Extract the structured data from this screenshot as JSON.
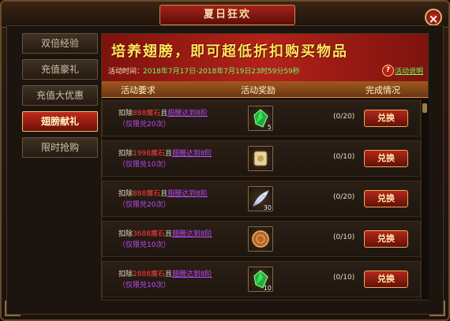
{
  "window": {
    "title": "夏日狂欢",
    "close_label": "×"
  },
  "nav": {
    "items": [
      {
        "label": "双倍经验",
        "active": false
      },
      {
        "label": "充值豪礼",
        "active": false
      },
      {
        "label": "充值大优惠",
        "active": false
      },
      {
        "label": "翅膀献礼",
        "active": true
      },
      {
        "label": "限时抢购",
        "active": false
      }
    ]
  },
  "banner": {
    "title": "培养翅膀，即可超低折扣购买物品",
    "time_label": "活动时间：",
    "time_value": "2018年7月17日-2018年7月19日23时59分59秒",
    "help_icon": "?",
    "rule_link": "活动说明"
  },
  "columns": {
    "requirement": "活动要求",
    "reward": "活动奖励",
    "status": "完成情况"
  },
  "rows": [
    {
      "prefix": "扣除",
      "price": "888魔石",
      "conjunction": "且",
      "level": "翅膀达到8阶",
      "limit": "（仅限兑20次）",
      "item_icon": "green-gem-icon",
      "item_count": "5",
      "progress": "(0/20)",
      "button": "兑换"
    },
    {
      "prefix": "扣除",
      "price": "1998魔石",
      "conjunction": "且",
      "level": "翅膀达到8阶",
      "limit": "（仅限兑10次）",
      "item_icon": "scroll-icon",
      "item_count": "",
      "progress": "(0/10)",
      "button": "兑换"
    },
    {
      "prefix": "扣除",
      "price": "888魔石",
      "conjunction": "且",
      "level": "翅膀达到8阶",
      "limit": "（仅限兑20次）",
      "item_icon": "feather-icon",
      "item_count": "30",
      "progress": "(0/20)",
      "button": "兑换"
    },
    {
      "prefix": "扣除",
      "price": "3688魔石",
      "conjunction": "且",
      "level": "翅膀达到8阶",
      "limit": "（仅限兑10次）",
      "item_icon": "bronze-coin-icon",
      "item_count": "",
      "progress": "(0/10)",
      "button": "兑换"
    },
    {
      "prefix": "扣除",
      "price": "2888魔石",
      "conjunction": "且",
      "level": "翅膀达到8阶",
      "limit": "（仅限兑10次）",
      "item_icon": "green-gem-icon",
      "item_count": "10",
      "progress": "(0/10)",
      "button": "兑换"
    }
  ]
}
